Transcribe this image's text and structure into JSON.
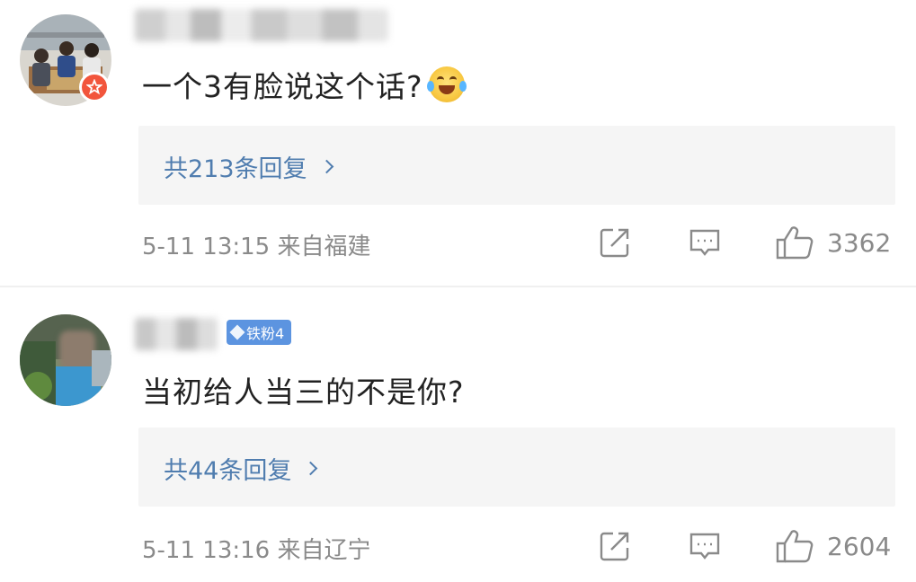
{
  "comments": [
    {
      "text": "一个3有脸说这个话?",
      "emoji": "laughing-tears-emoji",
      "verified_badge": "star-badge-icon",
      "replies_label": "共213条回复",
      "meta": "5-11 13:15 来自福建",
      "likes": "3362"
    },
    {
      "fan_badge": "铁粉4",
      "text": "当初给人当三的不是你?",
      "replies_label": "共44条回复",
      "meta": "5-11 13:16 来自辽宁",
      "likes": "2604"
    }
  ],
  "icons": {
    "share": "share-icon",
    "comment": "comment-icon",
    "like": "thumbs-up-icon",
    "chevron": "chevron-right-icon"
  },
  "colors": {
    "link": "#507daf",
    "meta": "#8a8a8a",
    "reply_bg": "#f5f5f5",
    "fan_badge": "#5c94e0",
    "verified_badge": "#f2553c"
  }
}
